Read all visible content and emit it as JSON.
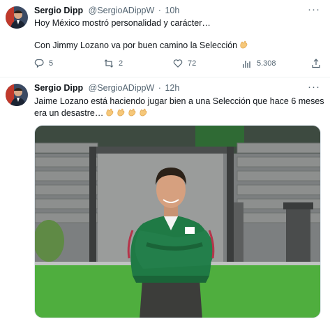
{
  "tweets": [
    {
      "name": "Sergio Dipp",
      "handle": "@SergioADippW",
      "separator": "·",
      "time": "10h",
      "line1": "Hoy México mostró personalidad y carácter…",
      "line2": "Con Jimmy Lozano va por buen camino la Selección",
      "replies": "5",
      "retweets": "2",
      "likes": "72",
      "views": "5.308"
    },
    {
      "name": "Sergio Dipp",
      "handle": "@SergioADippW",
      "separator": "·",
      "time": "12h",
      "line1": "Jaime Lozano está haciendo jugar bien a una Selección que hace 6 meses",
      "line2": "era un desastre…"
    }
  ],
  "icons": {
    "more": "more-dots-icon",
    "reply": "reply-icon",
    "retweet": "retweet-icon",
    "like": "heart-icon",
    "views": "views-icon",
    "share": "share-icon",
    "clap": "clapping-hands-emoji"
  },
  "colors": {
    "text": "#0f1419",
    "secondary": "#536471",
    "jacket_green": "#1f7a45",
    "grass": "#4fae3e"
  }
}
